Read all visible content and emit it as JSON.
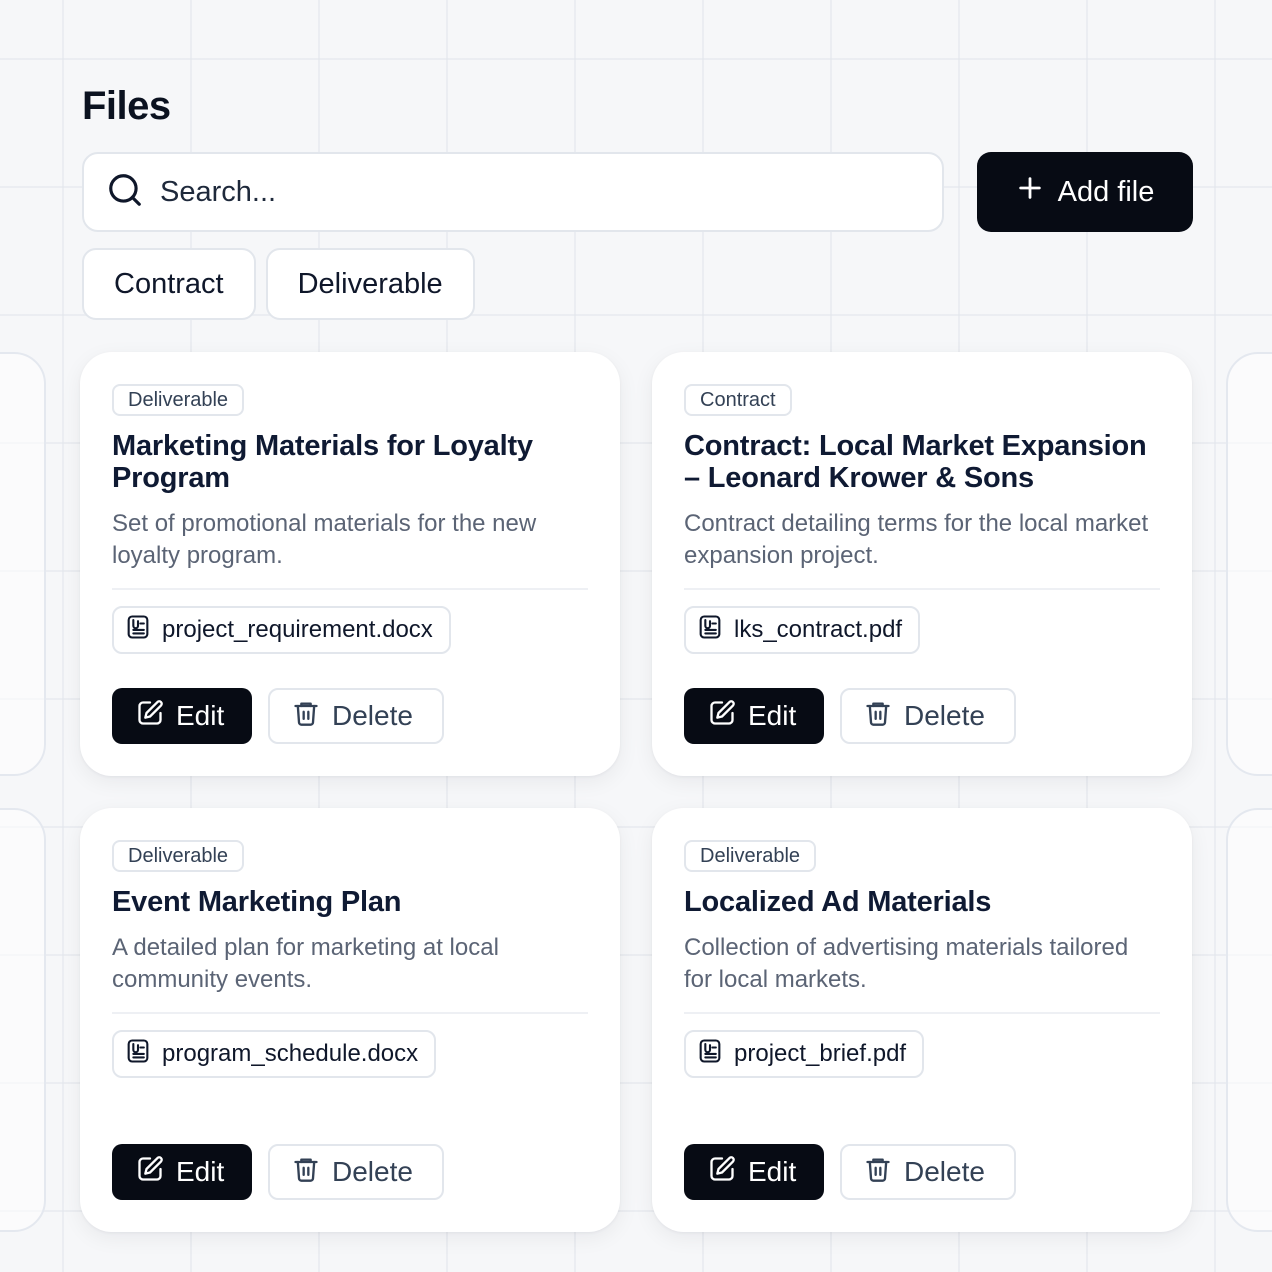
{
  "page": {
    "title": "Files"
  },
  "search": {
    "placeholder": "Search..."
  },
  "toolbar": {
    "add_file_label": "Add file"
  },
  "filters": [
    {
      "label": "Contract"
    },
    {
      "label": "Deliverable"
    }
  ],
  "actions": {
    "edit_label": "Edit",
    "delete_label": "Delete"
  },
  "files": [
    {
      "category": "Deliverable",
      "title": "Marketing Materials for Loyalty Program",
      "description": "Set of promotional materials for the new loyalty program.",
      "filename": "project_requirement.docx"
    },
    {
      "category": "Contract",
      "title": "Contract: Local Market Expansion – Leonard Krower & Sons",
      "description": "Contract detailing terms for the local market expansion project.",
      "filename": "lks_contract.pdf"
    },
    {
      "category": "Deliverable",
      "title": "Event Marketing Plan",
      "description": "A detailed plan for marketing at local community events.",
      "filename": "program_schedule.docx"
    },
    {
      "category": "Deliverable",
      "title": "Localized Ad Materials",
      "description": "Collection of advertising materials tailored for local markets.",
      "filename": "project_brief.pdf"
    }
  ],
  "colors": {
    "primary": "#070b14",
    "border": "#e2e6ec",
    "muted_text": "#5b6475",
    "background": "#f6f7f9"
  },
  "icons": {
    "search": "search-icon",
    "add": "plus-icon",
    "file": "file-icon",
    "edit": "edit-icon",
    "delete": "trash-icon"
  }
}
